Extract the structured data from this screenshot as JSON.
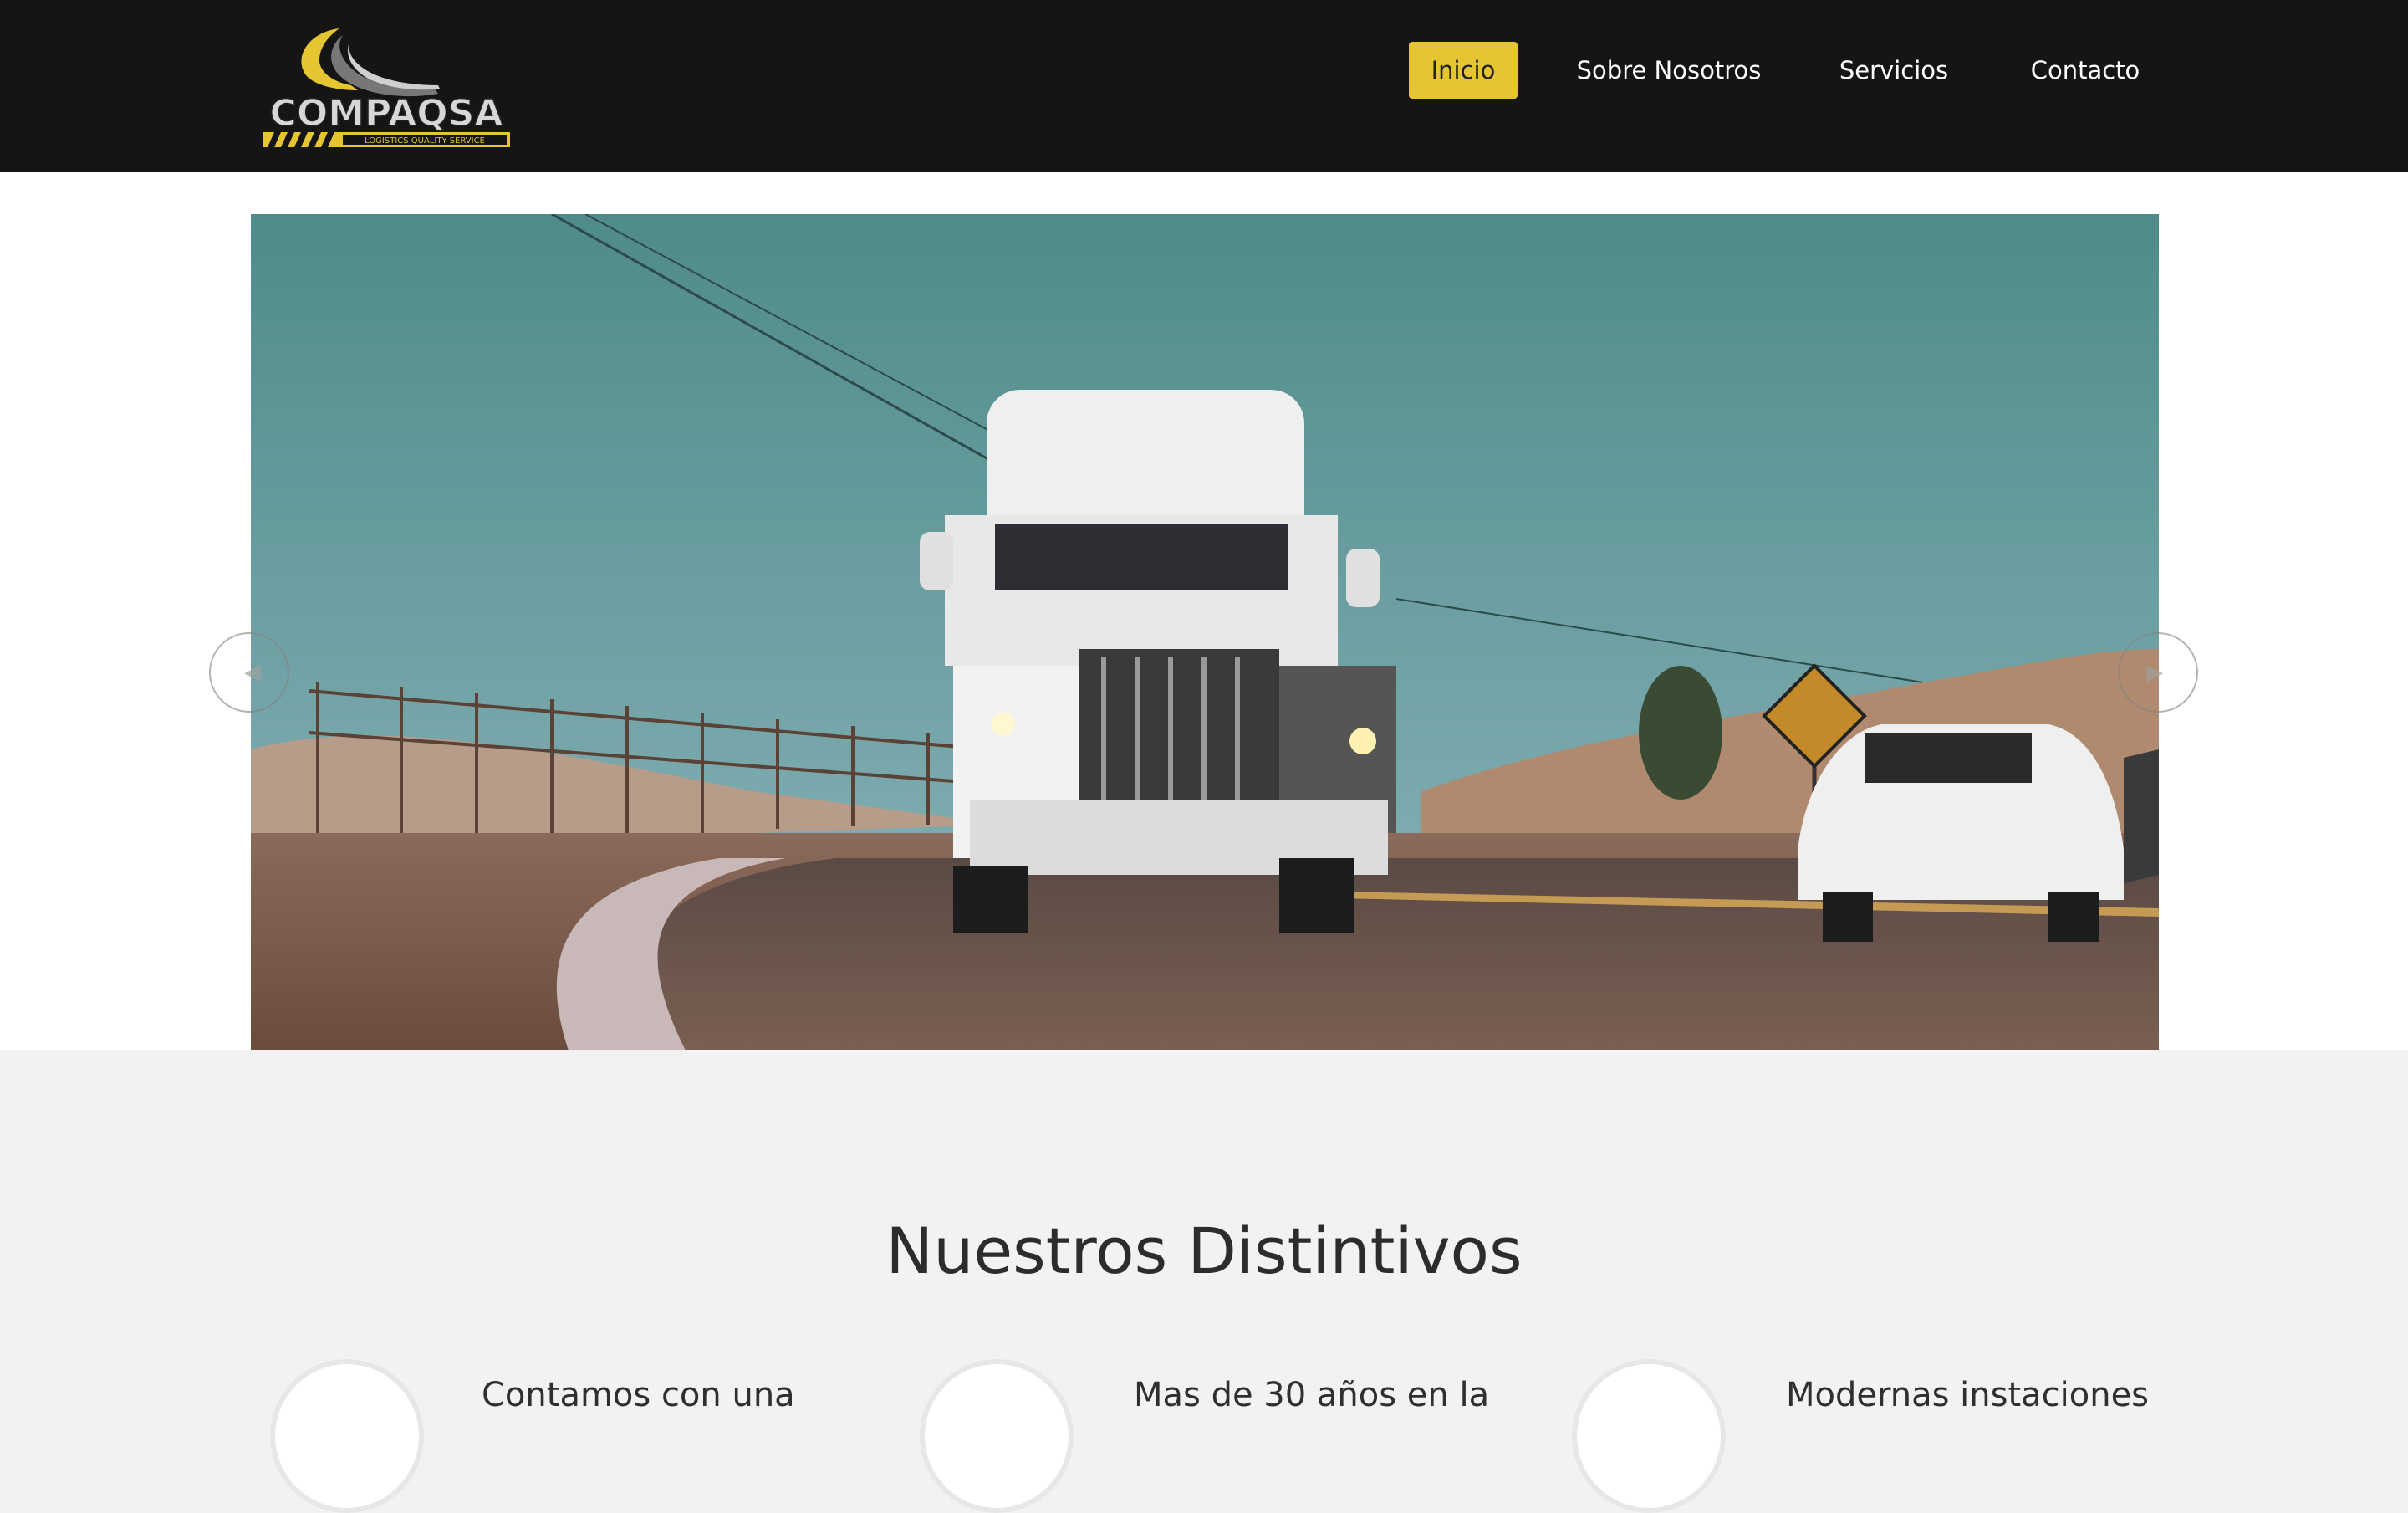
{
  "brand": {
    "name": "COMPAQSA",
    "tagline": "LOGISTICS QUALITY SERVICE",
    "accent_color": "#e6c533",
    "header_color": "#151515"
  },
  "nav": {
    "items": [
      {
        "label": "Inicio",
        "active": true
      },
      {
        "label": "Sobre Nosotros",
        "active": false
      },
      {
        "label": "Servicios",
        "active": false
      },
      {
        "label": "Contacto",
        "active": false
      }
    ]
  },
  "carousel": {
    "prev_icon": "chevron-left-icon",
    "next_icon": "chevron-right-icon",
    "slide_image": "white semi-truck on a desert road with a white car"
  },
  "section": {
    "title": "Nuestros Distintivos"
  },
  "features": [
    {
      "text": "Contamos con una"
    },
    {
      "text": "Mas de 30 años en la"
    },
    {
      "text": "Modernas instaciones"
    }
  ]
}
